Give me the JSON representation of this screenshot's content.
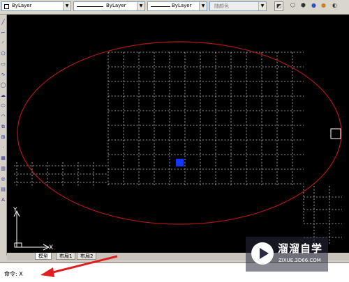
{
  "toolbar": {
    "layer_combo": "ByLayer",
    "linetype_combo": "ByLayer",
    "lineweight_combo": "ByLayer",
    "color_combo": "随颜色"
  },
  "tabs": [
    {
      "label": "模型",
      "active": true
    },
    {
      "label": "布局1",
      "active": false
    },
    {
      "label": "布局2",
      "active": false
    }
  ],
  "ucs": {
    "x_label": "X",
    "y_label": "Y"
  },
  "command_line": {
    "prompt": "命令: X"
  },
  "watermark": {
    "name": "溜溜自学",
    "url": "ZIXUE.3D66.COM"
  },
  "colors": {
    "canvas_bg": "#000000",
    "ellipse": "#b01818",
    "grid_dots": "#c8c8c8",
    "grip": "#1437ff",
    "arrow": "#e02020"
  },
  "icons": {
    "palette": [
      "line-icon",
      "polyline-icon",
      "arc-icon",
      "polygon-icon",
      "rectangle-icon",
      "spline-icon",
      "circle-icon",
      "revision-cloud-icon",
      "ellipse-icon",
      "ellipse-arc-icon",
      "insert-block-icon",
      "make-block-icon",
      "point-icon",
      "hatch-icon",
      "gradient-icon",
      "region-icon",
      "table-icon",
      "mtext-icon"
    ]
  }
}
